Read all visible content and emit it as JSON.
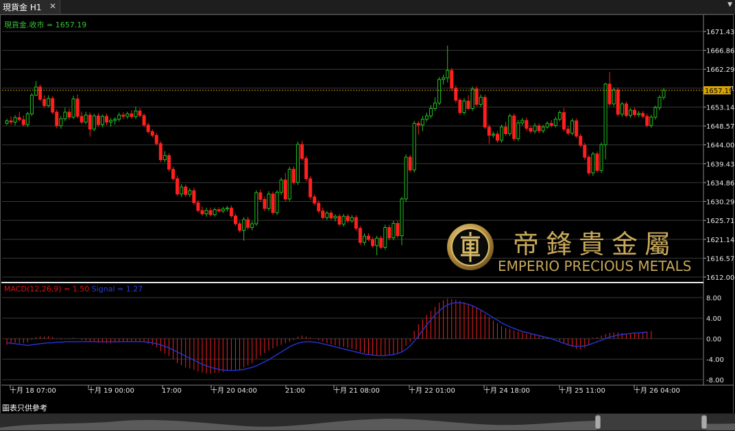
{
  "window": {
    "tab_title": "現貨金 H1",
    "close_glyph": "✕",
    "menu_glyph": "▼"
  },
  "main_chart": {
    "close_label": "現貨金.收市 = 1657.19",
    "last_price": "1657.19",
    "price_ticks": [
      "1671.43",
      "1666.86",
      "1662.29",
      "1657.71",
      "1653.14",
      "1648.57",
      "1644.00",
      "1639.43",
      "1634.86",
      "1630.29",
      "1625.71",
      "1621.14",
      "1616.57",
      "1612.00"
    ],
    "colors": {
      "up": "#22c422",
      "down": "#ff1f1f",
      "price_line": "#d9a400",
      "grid": "#3a3a3a"
    }
  },
  "macd": {
    "label_macd": "MACD(12,26,9) = 1.50",
    "label_signal": "Signal = 1.27",
    "ticks": [
      "8.00",
      "4.00",
      "0.00",
      "-4.00",
      "-8.00"
    ],
    "colors": {
      "hist": "#ff2020",
      "signal": "#2233cc"
    }
  },
  "time_axis": {
    "labels": [
      "十月 18 07:00",
      "十月 19 00:00",
      "17:00",
      "十月 20 04:00",
      "21:00",
      "十月 21 08:00",
      "十月 22 01:00",
      "十月 24 18:00",
      "十月 25 11:00",
      "十月 26 04:00"
    ]
  },
  "watermark": {
    "chinese": "帝鋒貴金屬",
    "english": "EMPERIO PRECIOUS METALS",
    "color": "#c8a95a"
  },
  "footer": {
    "disclaimer": "圖表只供參考"
  },
  "chart_data": {
    "type": "candlestick",
    "symbol": "現貨金",
    "timeframe": "H1",
    "ylim": [
      1612.0,
      1673.0
    ],
    "candles": [
      [
        1649.2,
        1650.3,
        1648.8,
        1649.8
      ],
      [
        1649.8,
        1650.9,
        1648.9,
        1649.5
      ],
      [
        1649.5,
        1651.2,
        1648.7,
        1650.6
      ],
      [
        1650.6,
        1652.0,
        1649.6,
        1650.1
      ],
      [
        1650.1,
        1651.1,
        1648.4,
        1648.9
      ],
      [
        1648.9,
        1652.0,
        1648.3,
        1651.5
      ],
      [
        1651.5,
        1656.5,
        1651.0,
        1656.0
      ],
      [
        1656.0,
        1659.4,
        1655.8,
        1658.0
      ],
      [
        1658.0,
        1658.6,
        1654.6,
        1655.0
      ],
      [
        1655.0,
        1656.0,
        1653.0,
        1653.5
      ],
      [
        1653.5,
        1656.0,
        1653.0,
        1655.2
      ],
      [
        1655.2,
        1655.8,
        1651.4,
        1651.9
      ],
      [
        1651.9,
        1652.5,
        1648.0,
        1648.6
      ],
      [
        1648.6,
        1651.0,
        1647.9,
        1650.3
      ],
      [
        1650.3,
        1653.0,
        1649.7,
        1651.9
      ],
      [
        1651.9,
        1652.8,
        1650.1,
        1650.7
      ],
      [
        1650.7,
        1655.9,
        1650.2,
        1655.1
      ],
      [
        1655.1,
        1656.2,
        1650.4,
        1650.9
      ],
      [
        1650.9,
        1652.0,
        1649.0,
        1649.5
      ],
      [
        1649.5,
        1652.0,
        1649.0,
        1651.2
      ],
      [
        1651.2,
        1651.8,
        1646.0,
        1647.8
      ],
      [
        1647.8,
        1651.5,
        1647.3,
        1651.0
      ],
      [
        1651.0,
        1651.7,
        1648.4,
        1648.9
      ],
      [
        1648.9,
        1651.3,
        1648.3,
        1650.9
      ],
      [
        1650.9,
        1651.6,
        1648.8,
        1649.5
      ],
      [
        1649.5,
        1650.5,
        1648.4,
        1649.9
      ],
      [
        1649.9,
        1650.7,
        1648.9,
        1650.2
      ],
      [
        1650.2,
        1651.8,
        1649.6,
        1651.2
      ],
      [
        1651.2,
        1651.9,
        1650.2,
        1650.9
      ],
      [
        1650.9,
        1652.0,
        1650.3,
        1651.5
      ],
      [
        1651.5,
        1652.4,
        1650.3,
        1650.8
      ],
      [
        1650.8,
        1653.3,
        1650.2,
        1652.2
      ],
      [
        1652.2,
        1652.9,
        1650.6,
        1651.1
      ],
      [
        1651.1,
        1651.6,
        1648.3,
        1648.8
      ],
      [
        1648.8,
        1649.4,
        1646.7,
        1647.2
      ],
      [
        1647.2,
        1647.8,
        1645.8,
        1646.3
      ],
      [
        1646.3,
        1646.9,
        1643.8,
        1644.3
      ],
      [
        1644.3,
        1644.9,
        1639.8,
        1640.4
      ],
      [
        1640.4,
        1642.5,
        1639.8,
        1641.4
      ],
      [
        1641.4,
        1642.0,
        1637.5,
        1638.1
      ],
      [
        1638.1,
        1638.7,
        1635.3,
        1635.8
      ],
      [
        1635.8,
        1636.6,
        1631.6,
        1632.1
      ],
      [
        1632.1,
        1634.5,
        1631.4,
        1633.8
      ],
      [
        1633.8,
        1634.4,
        1631.5,
        1632.0
      ],
      [
        1632.0,
        1633.5,
        1631.4,
        1632.9
      ],
      [
        1632.9,
        1633.6,
        1629.5,
        1630.0
      ],
      [
        1630.0,
        1630.6,
        1627.6,
        1628.1
      ],
      [
        1628.1,
        1629.1,
        1626.8,
        1627.3
      ],
      [
        1627.3,
        1628.8,
        1626.6,
        1628.1
      ],
      [
        1628.1,
        1628.8,
        1626.7,
        1627.1
      ],
      [
        1627.1,
        1628.8,
        1626.6,
        1628.3
      ],
      [
        1628.3,
        1628.9,
        1627.6,
        1628.0
      ],
      [
        1628.0,
        1629.0,
        1627.5,
        1628.5
      ],
      [
        1628.5,
        1629.2,
        1627.9,
        1628.7
      ],
      [
        1628.7,
        1629.3,
        1626.3,
        1626.8
      ],
      [
        1626.8,
        1627.4,
        1624.4,
        1624.9
      ],
      [
        1624.9,
        1625.5,
        1622.8,
        1623.3
      ],
      [
        1623.3,
        1626.5,
        1620.8,
        1625.9
      ],
      [
        1625.9,
        1626.6,
        1623.4,
        1624.0
      ],
      [
        1624.0,
        1625.5,
        1623.3,
        1624.9
      ],
      [
        1624.9,
        1633.0,
        1624.4,
        1632.4
      ],
      [
        1632.4,
        1633.2,
        1630.2,
        1630.8
      ],
      [
        1630.8,
        1631.5,
        1628.0,
        1628.6
      ],
      [
        1628.6,
        1632.8,
        1628.0,
        1632.1
      ],
      [
        1632.1,
        1632.7,
        1627.1,
        1627.6
      ],
      [
        1627.6,
        1633.0,
        1627.0,
        1632.5
      ],
      [
        1632.5,
        1636.1,
        1631.9,
        1635.5
      ],
      [
        1635.5,
        1637.2,
        1630.3,
        1630.9
      ],
      [
        1630.9,
        1638.7,
        1630.4,
        1638.1
      ],
      [
        1638.1,
        1638.8,
        1634.4,
        1634.9
      ],
      [
        1634.9,
        1644.8,
        1634.3,
        1644.1
      ],
      [
        1644.1,
        1645.0,
        1640.2,
        1640.7
      ],
      [
        1640.7,
        1641.3,
        1635.2,
        1635.8
      ],
      [
        1635.8,
        1636.4,
        1630.8,
        1631.4
      ],
      [
        1631.4,
        1632.0,
        1629.4,
        1629.9
      ],
      [
        1629.9,
        1630.5,
        1627.5,
        1628.0
      ],
      [
        1628.0,
        1628.8,
        1626.0,
        1626.4
      ],
      [
        1626.4,
        1628.0,
        1625.8,
        1627.5
      ],
      [
        1627.5,
        1628.1,
        1625.9,
        1626.3
      ],
      [
        1626.3,
        1627.2,
        1625.5,
        1626.7
      ],
      [
        1626.7,
        1627.3,
        1624.3,
        1624.8
      ],
      [
        1624.8,
        1627.3,
        1624.2,
        1626.7
      ],
      [
        1626.7,
        1627.3,
        1625.1,
        1625.6
      ],
      [
        1625.6,
        1627.0,
        1625.1,
        1626.4
      ],
      [
        1626.4,
        1627.0,
        1623.3,
        1623.8
      ],
      [
        1623.8,
        1624.4,
        1619.8,
        1620.4
      ],
      [
        1620.4,
        1622.6,
        1619.7,
        1621.9
      ],
      [
        1621.9,
        1622.6,
        1620.7,
        1621.1
      ],
      [
        1621.1,
        1621.7,
        1619.1,
        1619.6
      ],
      [
        1619.6,
        1622.0,
        1617.3,
        1621.4
      ],
      [
        1621.4,
        1622.0,
        1618.7,
        1619.2
      ],
      [
        1619.2,
        1624.7,
        1618.6,
        1624.0
      ],
      [
        1624.0,
        1624.7,
        1620.9,
        1621.5
      ],
      [
        1621.5,
        1625.6,
        1620.9,
        1625.0
      ],
      [
        1625.0,
        1625.6,
        1621.5,
        1622.0
      ],
      [
        1622.0,
        1631.4,
        1619.7,
        1630.9
      ],
      [
        1630.9,
        1641.7,
        1630.2,
        1641.0
      ],
      [
        1641.0,
        1641.6,
        1637.4,
        1637.9
      ],
      [
        1637.9,
        1649.8,
        1637.3,
        1649.2
      ],
      [
        1649.2,
        1649.8,
        1646.5,
        1648.8
      ],
      [
        1648.8,
        1651.0,
        1647.3,
        1650.2
      ],
      [
        1650.2,
        1651.8,
        1649.6,
        1651.0
      ],
      [
        1651.0,
        1653.6,
        1650.4,
        1652.8
      ],
      [
        1652.8,
        1655.5,
        1652.2,
        1654.1
      ],
      [
        1654.1,
        1660.4,
        1653.6,
        1659.8
      ],
      [
        1659.8,
        1661.0,
        1658.6,
        1660.2
      ],
      [
        1660.2,
        1668.0,
        1659.1,
        1662.0
      ],
      [
        1662.0,
        1662.6,
        1657.1,
        1657.7
      ],
      [
        1657.7,
        1658.4,
        1654.2,
        1654.8
      ],
      [
        1654.8,
        1655.3,
        1651.3,
        1651.8
      ],
      [
        1651.8,
        1655.3,
        1651.2,
        1654.6
      ],
      [
        1654.6,
        1656.0,
        1652.4,
        1652.8
      ],
      [
        1652.8,
        1658.1,
        1652.2,
        1657.5
      ],
      [
        1657.5,
        1658.2,
        1653.3,
        1653.8
      ],
      [
        1653.8,
        1656.2,
        1653.2,
        1655.5
      ],
      [
        1655.5,
        1656.1,
        1647.8,
        1648.3
      ],
      [
        1648.3,
        1648.9,
        1644.2,
        1646.3
      ],
      [
        1646.3,
        1647.2,
        1645.7,
        1646.6
      ],
      [
        1646.6,
        1647.3,
        1644.5,
        1645.1
      ],
      [
        1645.1,
        1648.9,
        1644.5,
        1648.3
      ],
      [
        1648.3,
        1649.6,
        1646.2,
        1646.7
      ],
      [
        1646.7,
        1651.5,
        1646.1,
        1651.0
      ],
      [
        1651.0,
        1651.6,
        1644.9,
        1645.5
      ],
      [
        1645.5,
        1650.0,
        1644.9,
        1649.3
      ],
      [
        1649.3,
        1650.5,
        1648.7,
        1649.9
      ],
      [
        1649.9,
        1650.6,
        1647.4,
        1648.0
      ],
      [
        1648.0,
        1648.6,
        1646.8,
        1647.3
      ],
      [
        1647.3,
        1649.3,
        1646.7,
        1648.6
      ],
      [
        1648.6,
        1649.2,
        1646.8,
        1647.4
      ],
      [
        1647.4,
        1648.8,
        1646.8,
        1648.3
      ],
      [
        1648.3,
        1649.7,
        1647.9,
        1649.2
      ],
      [
        1649.2,
        1650.0,
        1648.2,
        1648.7
      ],
      [
        1648.7,
        1650.7,
        1648.2,
        1650.2
      ],
      [
        1650.2,
        1652.3,
        1649.7,
        1651.8
      ],
      [
        1651.8,
        1652.9,
        1647.2,
        1647.8
      ],
      [
        1647.8,
        1648.5,
        1646.3,
        1646.8
      ],
      [
        1646.8,
        1650.4,
        1646.3,
        1649.8
      ],
      [
        1649.8,
        1650.4,
        1645.6,
        1646.1
      ],
      [
        1646.1,
        1646.7,
        1643.4,
        1643.9
      ],
      [
        1643.9,
        1644.5,
        1640.4,
        1641.0
      ],
      [
        1641.0,
        1641.6,
        1636.7,
        1637.2
      ],
      [
        1637.2,
        1642.3,
        1636.5,
        1641.8
      ],
      [
        1641.8,
        1642.4,
        1637.3,
        1637.8
      ],
      [
        1637.8,
        1644.6,
        1637.2,
        1644.0
      ],
      [
        1644.0,
        1659.0,
        1640.5,
        1658.7
      ],
      [
        1658.7,
        1661.6,
        1653.4,
        1653.9
      ],
      [
        1653.9,
        1657.9,
        1653.3,
        1657.3
      ],
      [
        1657.3,
        1657.9,
        1650.9,
        1651.4
      ],
      [
        1651.4,
        1654.4,
        1650.8,
        1653.9
      ],
      [
        1653.9,
        1654.5,
        1650.6,
        1651.1
      ],
      [
        1651.1,
        1652.9,
        1650.5,
        1652.4
      ],
      [
        1652.4,
        1653.0,
        1650.8,
        1651.3
      ],
      [
        1651.3,
        1652.2,
        1650.7,
        1651.6
      ],
      [
        1651.6,
        1652.2,
        1650.4,
        1650.9
      ],
      [
        1650.9,
        1651.5,
        1648.2,
        1648.7
      ],
      [
        1648.7,
        1651.3,
        1648.1,
        1650.7
      ],
      [
        1650.7,
        1653.5,
        1650.1,
        1653.0
      ],
      [
        1653.0,
        1656.0,
        1652.4,
        1655.5
      ],
      [
        1655.5,
        1657.7,
        1654.9,
        1657.2
      ]
    ],
    "macd_hist": [
      -1.2,
      -1.0,
      -0.8,
      -0.9,
      -0.9,
      -0.7,
      -0.2,
      0.3,
      0.4,
      0.4,
      0.5,
      0.3,
      -0.1,
      -0.2,
      -0.1,
      -0.1,
      0.2,
      0.0,
      -0.3,
      -0.4,
      -0.7,
      -0.6,
      -0.8,
      -0.8,
      -0.9,
      -0.9,
      -0.8,
      -0.7,
      -0.7,
      -0.6,
      -0.6,
      -0.5,
      -0.5,
      -0.7,
      -1.0,
      -1.3,
      -1.7,
      -2.4,
      -2.9,
      -3.4,
      -4.0,
      -4.8,
      -5.2,
      -5.6,
      -5.8,
      -6.1,
      -6.4,
      -6.6,
      -6.8,
      -6.8,
      -6.7,
      -6.6,
      -6.5,
      -6.3,
      -6.2,
      -6.1,
      -6.0,
      -5.6,
      -5.2,
      -4.8,
      -3.9,
      -3.3,
      -2.8,
      -2.3,
      -1.9,
      -1.5,
      -1.2,
      -0.9,
      -0.6,
      -0.3,
      0.4,
      0.6,
      0.4,
      0.2,
      0.0,
      -0.3,
      -0.6,
      -0.9,
      -1.1,
      -1.3,
      -1.5,
      -1.6,
      -1.8,
      -2.0,
      -2.2,
      -2.6,
      -2.8,
      -3.0,
      -3.1,
      -3.2,
      -3.2,
      -3.2,
      -3.1,
      -3.0,
      -2.9,
      -2.5,
      -1.4,
      -0.6,
      1.5,
      2.8,
      3.8,
      4.6,
      5.4,
      6.2,
      7.0,
      7.5,
      7.8,
      7.7,
      7.6,
      7.4,
      7.1,
      6.8,
      6.4,
      6.1,
      5.5,
      4.8,
      4.2,
      3.5,
      3.0,
      2.4,
      2.1,
      1.9,
      1.6,
      1.4,
      1.2,
      1.0,
      0.9,
      0.8,
      0.6,
      0.5,
      0.3,
      0.2,
      0.0,
      -0.4,
      -0.8,
      -1.2,
      -1.6,
      -2.0,
      -2.1,
      -1.8,
      -1.3,
      0.2,
      0.3,
      0.6,
      0.9,
      1.1,
      1.2,
      1.2,
      1.1,
      1.0,
      0.9,
      1.0,
      1.1,
      1.2,
      1.4,
      1.5
    ],
    "macd_signal": [
      -0.8,
      -0.9,
      -1.0,
      -1.1,
      -1.2,
      -1.3,
      -1.2,
      -1.1,
      -1.0,
      -0.9,
      -0.8,
      -0.8,
      -0.7,
      -0.7,
      -0.6,
      -0.6,
      -0.6,
      -0.6,
      -0.6,
      -0.6,
      -0.6,
      -0.6,
      -0.6,
      -0.6,
      -0.6,
      -0.6,
      -0.6,
      -0.6,
      -0.6,
      -0.6,
      -0.6,
      -0.6,
      -0.6,
      -0.6,
      -0.7,
      -0.8,
      -1.0,
      -1.2,
      -1.5,
      -1.8,
      -2.2,
      -2.6,
      -3.0,
      -3.4,
      -3.8,
      -4.2,
      -4.6,
      -5.0,
      -5.3,
      -5.6,
      -5.8,
      -6.0,
      -6.1,
      -6.2,
      -6.2,
      -6.2,
      -6.1,
      -6.0,
      -5.8,
      -5.6,
      -5.3,
      -4.9,
      -4.5,
      -4.1,
      -3.6,
      -3.1,
      -2.6,
      -2.1,
      -1.6,
      -1.2,
      -0.9,
      -0.7,
      -0.6,
      -0.6,
      -0.7,
      -0.8,
      -1.0,
      -1.2,
      -1.4,
      -1.6,
      -1.8,
      -2.0,
      -2.2,
      -2.4,
      -2.6,
      -2.8,
      -3.0,
      -3.1,
      -3.2,
      -3.3,
      -3.3,
      -3.3,
      -3.2,
      -3.1,
      -2.9,
      -2.6,
      -2.1,
      -1.4,
      -0.5,
      0.5,
      1.6,
      2.7,
      3.7,
      4.6,
      5.4,
      6.1,
      6.6,
      6.9,
      7.0,
      7.0,
      6.9,
      6.7,
      6.4,
      6.0,
      5.6,
      5.1,
      4.6,
      4.1,
      3.6,
      3.1,
      2.7,
      2.3,
      2.0,
      1.7,
      1.4,
      1.2,
      1.0,
      0.8,
      0.6,
      0.4,
      0.2,
      0.0,
      -0.3,
      -0.6,
      -0.9,
      -1.2,
      -1.4,
      -1.5,
      -1.5,
      -1.4,
      -1.2,
      -0.9,
      -0.6,
      -0.3,
      0.0,
      0.3,
      0.5,
      0.7,
      0.8,
      0.9,
      1.0,
      1.1,
      1.1,
      1.2,
      1.3
    ]
  }
}
